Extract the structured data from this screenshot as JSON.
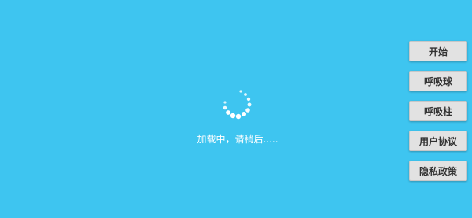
{
  "loading": {
    "text": "加载中，请稍后.....",
    "spinner_icon": "loading-spinner-icon"
  },
  "menu": {
    "items": [
      {
        "label": "开始"
      },
      {
        "label": "呼吸球"
      },
      {
        "label": "呼吸柱"
      },
      {
        "label": "用户协议"
      },
      {
        "label": "隐私政策"
      }
    ]
  },
  "colors": {
    "background": "#3ec5f0",
    "button_bg": "#e2e2e2",
    "button_text": "#333333",
    "loading_text": "#ffffff"
  }
}
